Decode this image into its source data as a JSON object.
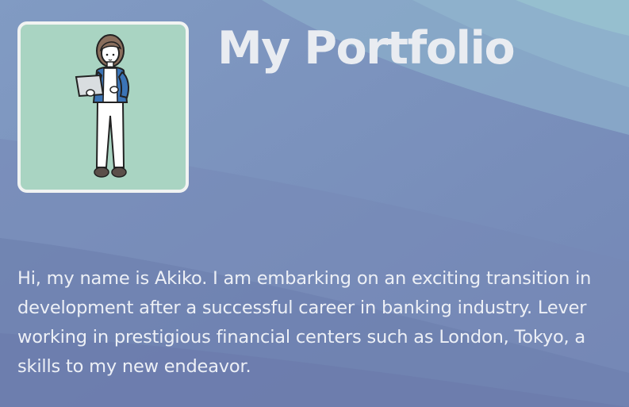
{
  "header": {
    "title": "My Portfolio"
  },
  "profile": {
    "avatar_icon": "person-with-laptop-illustration"
  },
  "bio": {
    "lines": [
      "Hi, my name is Akiko. I am embarking on an exciting transition in",
      "development after a successful career in banking industry. Lever",
      "working in prestigious financial centers such as London, Tokyo, a",
      "skills to my new endeavor."
    ]
  },
  "colors": {
    "background": "#7f92bd",
    "wave_light": "#93b9cb",
    "wave_dark": "#6e7fae",
    "avatar_bg": "#a9d4c2",
    "text": "#edf0f6"
  }
}
